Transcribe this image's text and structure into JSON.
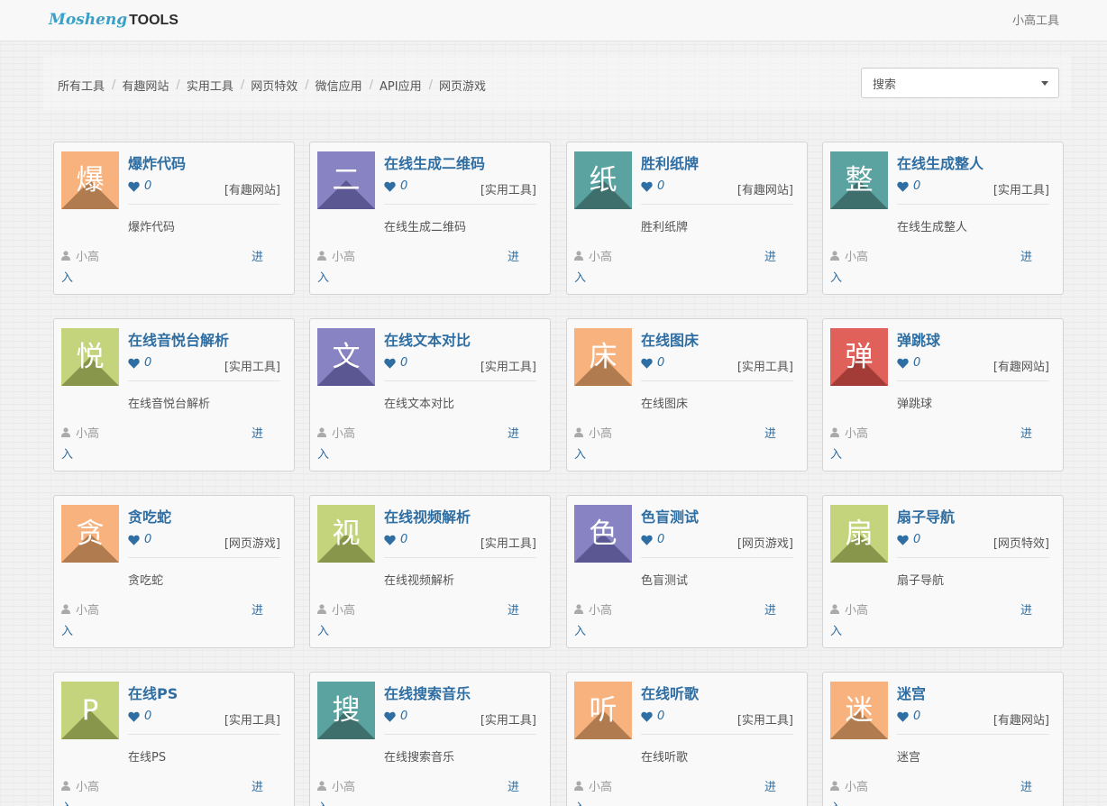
{
  "header": {
    "logo_part1": "Mosheng",
    "logo_part2": "TOOLS",
    "user_link": "小高工具"
  },
  "nav": {
    "items": [
      "所有工具",
      "有趣网站",
      "实用工具",
      "网页特效",
      "微信应用",
      "API应用",
      "网页游戏"
    ]
  },
  "search": {
    "selected": "搜索"
  },
  "cards": [
    {
      "glyph": "爆",
      "color": "#f7b27e",
      "shadow": "#b07c4f",
      "title": "爆炸代码",
      "likes": "0",
      "category": "[有趣网站]",
      "desc": "爆炸代码",
      "author": "小高",
      "enter1": "进",
      "enter2": "入"
    },
    {
      "glyph": "二",
      "color": "#8883c2",
      "shadow": "#5b5792",
      "title": "在线生成二维码",
      "likes": "0",
      "category": "[实用工具]",
      "desc": "在线生成二维码",
      "author": "小高",
      "enter1": "进",
      "enter2": "入"
    },
    {
      "glyph": "纸",
      "color": "#5ba3a0",
      "shadow": "#3e6f6c",
      "title": "胜利纸牌",
      "likes": "0",
      "category": "[有趣网站]",
      "desc": "胜利纸牌",
      "author": "小高",
      "enter1": "进",
      "enter2": "入"
    },
    {
      "glyph": "整",
      "color": "#5ba3a0",
      "shadow": "#3e6f6c",
      "title": "在线生成整人",
      "likes": "0",
      "category": "[实用工具]",
      "desc": "在线生成整人",
      "author": "小高",
      "enter1": "进",
      "enter2": "入"
    },
    {
      "glyph": "悦",
      "color": "#c3d47c",
      "shadow": "#88964c",
      "title": "在线音悦台解析",
      "likes": "0",
      "category": "[实用工具]",
      "desc": "在线音悦台解析",
      "author": "小高",
      "enter1": "进",
      "enter2": "入"
    },
    {
      "glyph": "文",
      "color": "#8883c2",
      "shadow": "#5b5792",
      "title": "在线文本对比",
      "likes": "0",
      "category": "[实用工具]",
      "desc": "在线文本对比",
      "author": "小高",
      "enter1": "进",
      "enter2": "入"
    },
    {
      "glyph": "床",
      "color": "#f7b27e",
      "shadow": "#b07c4f",
      "title": "在线图床",
      "likes": "0",
      "category": "[实用工具]",
      "desc": "在线图床",
      "author": "小高",
      "enter1": "进",
      "enter2": "入"
    },
    {
      "glyph": "弹",
      "color": "#e0605a",
      "shadow": "#a33b37",
      "title": "弹跳球",
      "likes": "0",
      "category": "[有趣网站]",
      "desc": "弹跳球",
      "author": "小高",
      "enter1": "进",
      "enter2": "入"
    },
    {
      "glyph": "贪",
      "color": "#f7b27e",
      "shadow": "#b07c4f",
      "title": "贪吃蛇",
      "likes": "0",
      "category": "[网页游戏]",
      "desc": "贪吃蛇",
      "author": "小高",
      "enter1": "进",
      "enter2": "入"
    },
    {
      "glyph": "视",
      "color": "#c3d47c",
      "shadow": "#88964c",
      "title": "在线视频解析",
      "likes": "0",
      "category": "[实用工具]",
      "desc": "在线视频解析",
      "author": "小高",
      "enter1": "进",
      "enter2": "入"
    },
    {
      "glyph": "色",
      "color": "#8883c2",
      "shadow": "#5b5792",
      "title": "色盲测试",
      "likes": "0",
      "category": "[网页游戏]",
      "desc": "色盲测试",
      "author": "小高",
      "enter1": "进",
      "enter2": "入"
    },
    {
      "glyph": "扇",
      "color": "#c3d47c",
      "shadow": "#88964c",
      "title": "扇子导航",
      "likes": "0",
      "category": "[网页特效]",
      "desc": "扇子导航",
      "author": "小高",
      "enter1": "进",
      "enter2": "入"
    },
    {
      "glyph": "P",
      "color": "#c3d47c",
      "shadow": "#88964c",
      "title": "在线PS",
      "likes": "0",
      "category": "[实用工具]",
      "desc": "在线PS",
      "author": "小高",
      "enter1": "进",
      "enter2": "入"
    },
    {
      "glyph": "搜",
      "color": "#5ba3a0",
      "shadow": "#3e6f6c",
      "title": "在线搜索音乐",
      "likes": "0",
      "category": "[实用工具]",
      "desc": "在线搜索音乐",
      "author": "小高",
      "enter1": "进",
      "enter2": "入"
    },
    {
      "glyph": "听",
      "color": "#f7b27e",
      "shadow": "#b07c4f",
      "title": "在线听歌",
      "likes": "0",
      "category": "[实用工具]",
      "desc": "在线听歌",
      "author": "小高",
      "enter1": "进",
      "enter2": "入"
    },
    {
      "glyph": "迷",
      "color": "#f7b27e",
      "shadow": "#b07c4f",
      "title": "迷宫",
      "likes": "0",
      "category": "[有趣网站]",
      "desc": "迷宫",
      "author": "小高",
      "enter1": "进",
      "enter2": "入"
    }
  ]
}
